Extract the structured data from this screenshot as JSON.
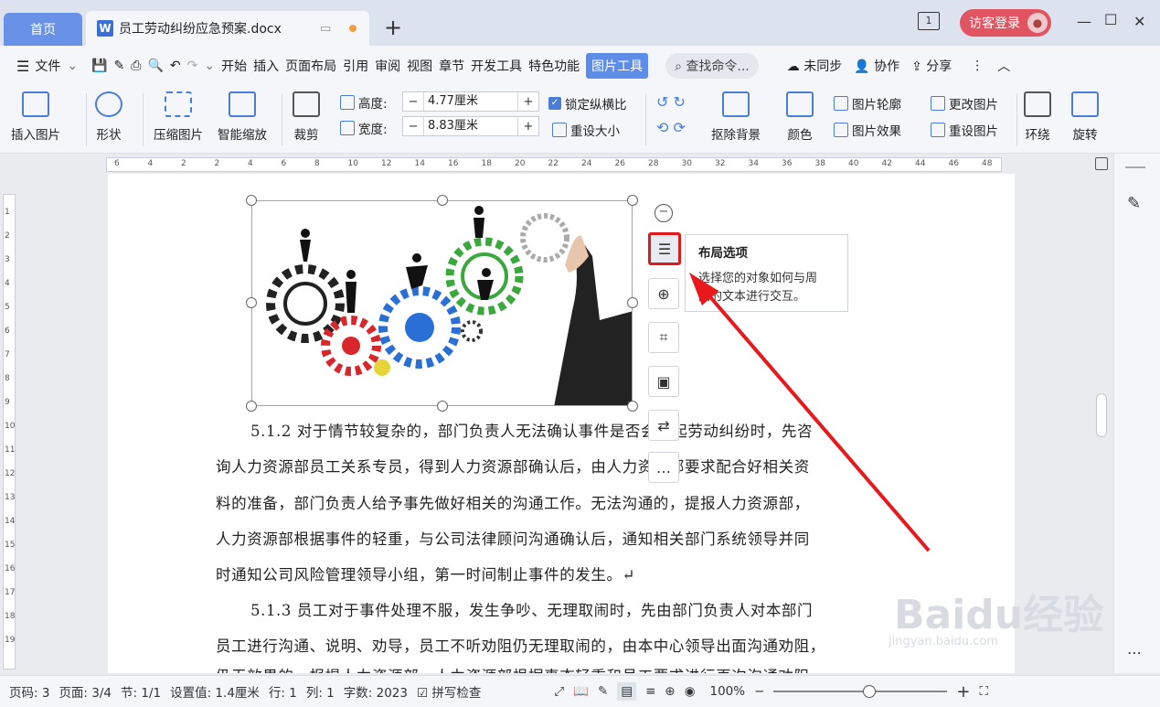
{
  "tabs": {
    "home": "首页",
    "doc_title": "员工劳动纠纷应急预案.docx"
  },
  "window": {
    "login": "访客登录"
  },
  "menu": {
    "file": "文件",
    "items": [
      "开始",
      "插入",
      "页面布局",
      "引用",
      "审阅",
      "视图",
      "章节",
      "开发工具",
      "特色功能"
    ],
    "active": "图片工具",
    "search": "查找命令...",
    "unsync": "未同步",
    "collab": "协作",
    "share": "分享"
  },
  "ribbon": {
    "insert_picture": "插入图片",
    "shape": "形状",
    "compress": "压缩图片",
    "smart_zoom": "智能缩放",
    "crop": "裁剪",
    "height_label": "高度:",
    "height_value": "4.77厘米",
    "width_label": "宽度:",
    "width_value": "8.83厘米",
    "lock_ratio": "锁定纵横比",
    "reset_size": "重设大小",
    "remove_bg": "抠除背景",
    "color": "颜色",
    "outline": "图片轮廓",
    "effect": "图片效果",
    "change_pic": "更改图片",
    "reset_pic": "重设图片",
    "wrap": "环绕",
    "rotate": "旋转"
  },
  "ruler": {
    "h_ticks": [
      "6",
      "4",
      "2",
      "2",
      "4",
      "6",
      "8",
      "10",
      "12",
      "14",
      "16",
      "18",
      "20",
      "22",
      "24",
      "26",
      "28",
      "30",
      "32",
      "34",
      "36",
      "38",
      "40",
      "42",
      "44",
      "46",
      "48"
    ],
    "v_ticks": [
      "1",
      "2",
      "3",
      "4",
      "5",
      "6",
      "7",
      "8",
      "9",
      "10",
      "11",
      "12",
      "13",
      "14",
      "15",
      "16",
      "17",
      "18",
      "19"
    ]
  },
  "tooltip": {
    "title": "布局选项",
    "desc1": "选择您的对象如何与周",
    "desc2": "围的文本进行交互。"
  },
  "doc": {
    "lines": [
      "5.1.2 对于情节较复杂的，部门负责人无法确认事件是否会引起劳动纠纷时，先咨",
      "询人力资源部员工关系专员，得到人力资源部确认后，由人力资源部要求配合好相关资",
      "料的准备，部门负责人给予事先做好相关的沟通工作。无法沟通的，提报人力资源部，",
      "人力资源部根据事件的轻重，与公司法律顾问沟通确认后，通知相关部门系统领导并同",
      "时通知公司风险管理领导小组，第一时间制止事件的发生。↵",
      "5.1.3 员工对于事件处理不服，发生争吵、无理取闹时，先由部门负责人对本部门",
      "员工进行沟通、说明、劝导，员工不听劝阻仍无理取闹的，由本中心领导出面沟通劝阻，",
      "仍无效果的，报提人力资源部，人力资源部根据事态轻重和员工要求进行再次沟通劝阻，"
    ]
  },
  "status": {
    "page_no": "页码: 3",
    "pages": "页面: 3/4",
    "section": "节: 1/1",
    "setting": "设置值: 1.4厘米",
    "row": "行: 1",
    "col": "列: 1",
    "words": "字数: 2023",
    "spell": "拼写检查",
    "zoom": "100%"
  },
  "watermark": {
    "main": "Baidu经验",
    "sub": "jingyan.baidu.com"
  }
}
